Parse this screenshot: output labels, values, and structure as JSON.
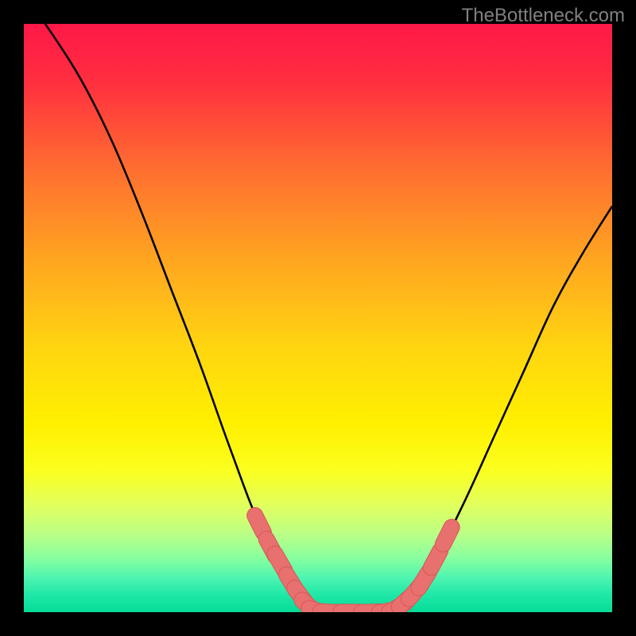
{
  "watermark": "TheBottleneck.com",
  "colors": {
    "frame_bg": "#000000",
    "curve": "#000000",
    "marker_fill": "#e8716f",
    "marker_stroke": "#d95a58",
    "gradient_stops": [
      {
        "offset": "0%",
        "color": "#ff1848"
      },
      {
        "offset": "10%",
        "color": "#ff2f3f"
      },
      {
        "offset": "25%",
        "color": "#ff6f30"
      },
      {
        "offset": "40%",
        "color": "#ffa520"
      },
      {
        "offset": "55%",
        "color": "#ffd510"
      },
      {
        "offset": "68%",
        "color": "#fff000"
      },
      {
        "offset": "76%",
        "color": "#fbff20"
      },
      {
        "offset": "82%",
        "color": "#e0ff60"
      },
      {
        "offset": "87%",
        "color": "#b8ff88"
      },
      {
        "offset": "91%",
        "color": "#85ffa0"
      },
      {
        "offset": "94%",
        "color": "#50f5b0"
      },
      {
        "offset": "97%",
        "color": "#20e8a8"
      },
      {
        "offset": "100%",
        "color": "#05dc96"
      }
    ]
  },
  "chart_data": {
    "type": "line",
    "title": "",
    "xlabel": "",
    "ylabel": "",
    "x_range": [
      0,
      100
    ],
    "y_range": [
      0,
      100
    ],
    "curve": [
      {
        "x": 0,
        "y": 105
      },
      {
        "x": 5,
        "y": 98
      },
      {
        "x": 10,
        "y": 90
      },
      {
        "x": 15,
        "y": 80
      },
      {
        "x": 20,
        "y": 68
      },
      {
        "x": 25,
        "y": 55
      },
      {
        "x": 30,
        "y": 42
      },
      {
        "x": 35,
        "y": 28
      },
      {
        "x": 40,
        "y": 15
      },
      {
        "x": 45,
        "y": 6
      },
      {
        "x": 48,
        "y": 1.5
      },
      {
        "x": 50,
        "y": 0.2
      },
      {
        "x": 54,
        "y": 0
      },
      {
        "x": 58,
        "y": 0
      },
      {
        "x": 62,
        "y": 0.2
      },
      {
        "x": 64,
        "y": 1.0
      },
      {
        "x": 67,
        "y": 4
      },
      {
        "x": 70,
        "y": 9
      },
      {
        "x": 75,
        "y": 19
      },
      {
        "x": 80,
        "y": 30
      },
      {
        "x": 85,
        "y": 41
      },
      {
        "x": 90,
        "y": 52
      },
      {
        "x": 95,
        "y": 61
      },
      {
        "x": 100,
        "y": 69
      }
    ],
    "markers": [
      {
        "x": 40.0,
        "y": 15.0
      },
      {
        "x": 42.0,
        "y": 11.0
      },
      {
        "x": 43.5,
        "y": 8.5
      },
      {
        "x": 45.5,
        "y": 5.0
      },
      {
        "x": 47.0,
        "y": 2.8
      },
      {
        "x": 48.5,
        "y": 1.0
      },
      {
        "x": 50.0,
        "y": 0.2
      },
      {
        "x": 52.0,
        "y": 0.0
      },
      {
        "x": 55.5,
        "y": 0.0
      },
      {
        "x": 59.0,
        "y": 0.0
      },
      {
        "x": 62.0,
        "y": 0.2
      },
      {
        "x": 63.5,
        "y": 0.8
      },
      {
        "x": 65.0,
        "y": 2.0
      },
      {
        "x": 66.5,
        "y": 3.5
      },
      {
        "x": 68.0,
        "y": 5.5
      },
      {
        "x": 70.0,
        "y": 9.0
      },
      {
        "x": 72.0,
        "y": 13.0
      }
    ]
  }
}
